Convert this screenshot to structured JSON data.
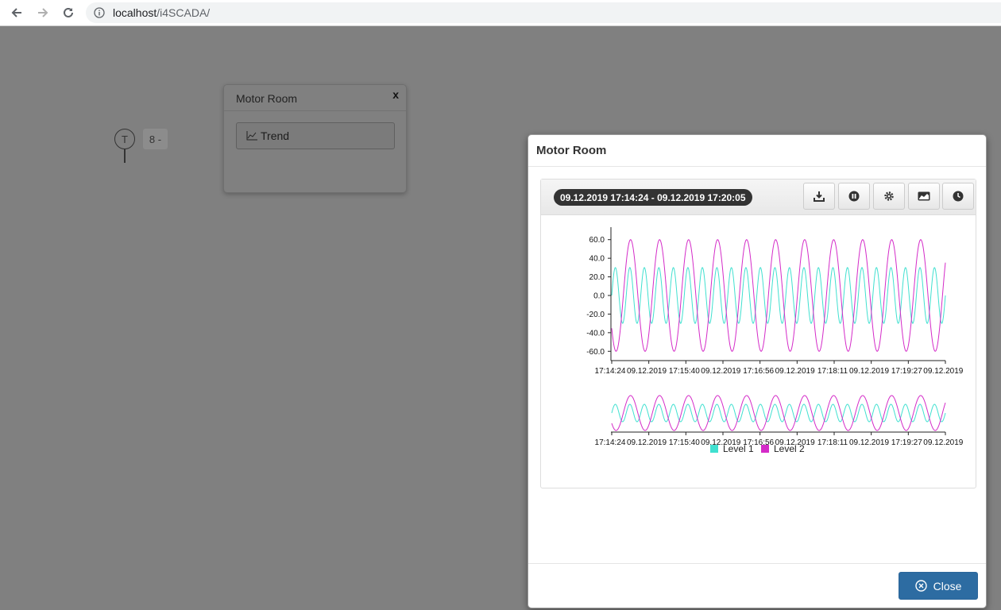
{
  "browser": {
    "url_host": "localhost",
    "url_path": "/i4SCADA/"
  },
  "widget": {
    "symbol": "T",
    "value": "8 -"
  },
  "popover": {
    "title": "Motor Room",
    "close": "x",
    "trend_label": "Trend"
  },
  "modal": {
    "title": "Motor Room",
    "range": "09.12.2019 17:14:24 - 09.12.2019 17:20:05",
    "toolbar": [
      "download-icon",
      "pause-icon",
      "gear-icon",
      "area-chart-icon",
      "clock-icon"
    ],
    "close_label": "Close"
  },
  "colors": {
    "level1": "#40e0d0",
    "level2": "#d42bc8",
    "primary": "#2d6ca2"
  },
  "chart_data": {
    "type": "line",
    "y_ticks": [
      "60.0",
      "40.0",
      "20.0",
      "0.0",
      "-20.0",
      "-40.0",
      "-60.0"
    ],
    "ylim": [
      -70,
      70
    ],
    "x_ticks": [
      {
        "time": "17:14:24",
        "date": "09.12.2019"
      },
      {
        "time": "17:15:40",
        "date": "09.12.2019"
      },
      {
        "time": "17:16:56",
        "date": "09.12.2019"
      },
      {
        "time": "17:18:11",
        "date": "09.12.2019"
      },
      {
        "time": "17:19:27",
        "date": "09.12.2019"
      }
    ],
    "overview_x_ticks": [
      {
        "time": "17:14:24",
        "date": "09.12.2019"
      },
      {
        "time": "17:15:40",
        "date": "09.12.2019"
      },
      {
        "time": "17:16:56",
        "date": "09.12.2019"
      },
      {
        "time": "17:18:11",
        "date": "09.12.2019"
      },
      {
        "time": "17:19:27",
        "date": "09.12.2019"
      }
    ],
    "series": [
      {
        "name": "Level 1",
        "amplitude": 30,
        "cycles": 23,
        "phase": 0
      },
      {
        "name": "Level 2",
        "amplitude": 60,
        "cycles": 11.5,
        "phase": 0.6
      }
    ],
    "legend_position": "bottom-center"
  }
}
